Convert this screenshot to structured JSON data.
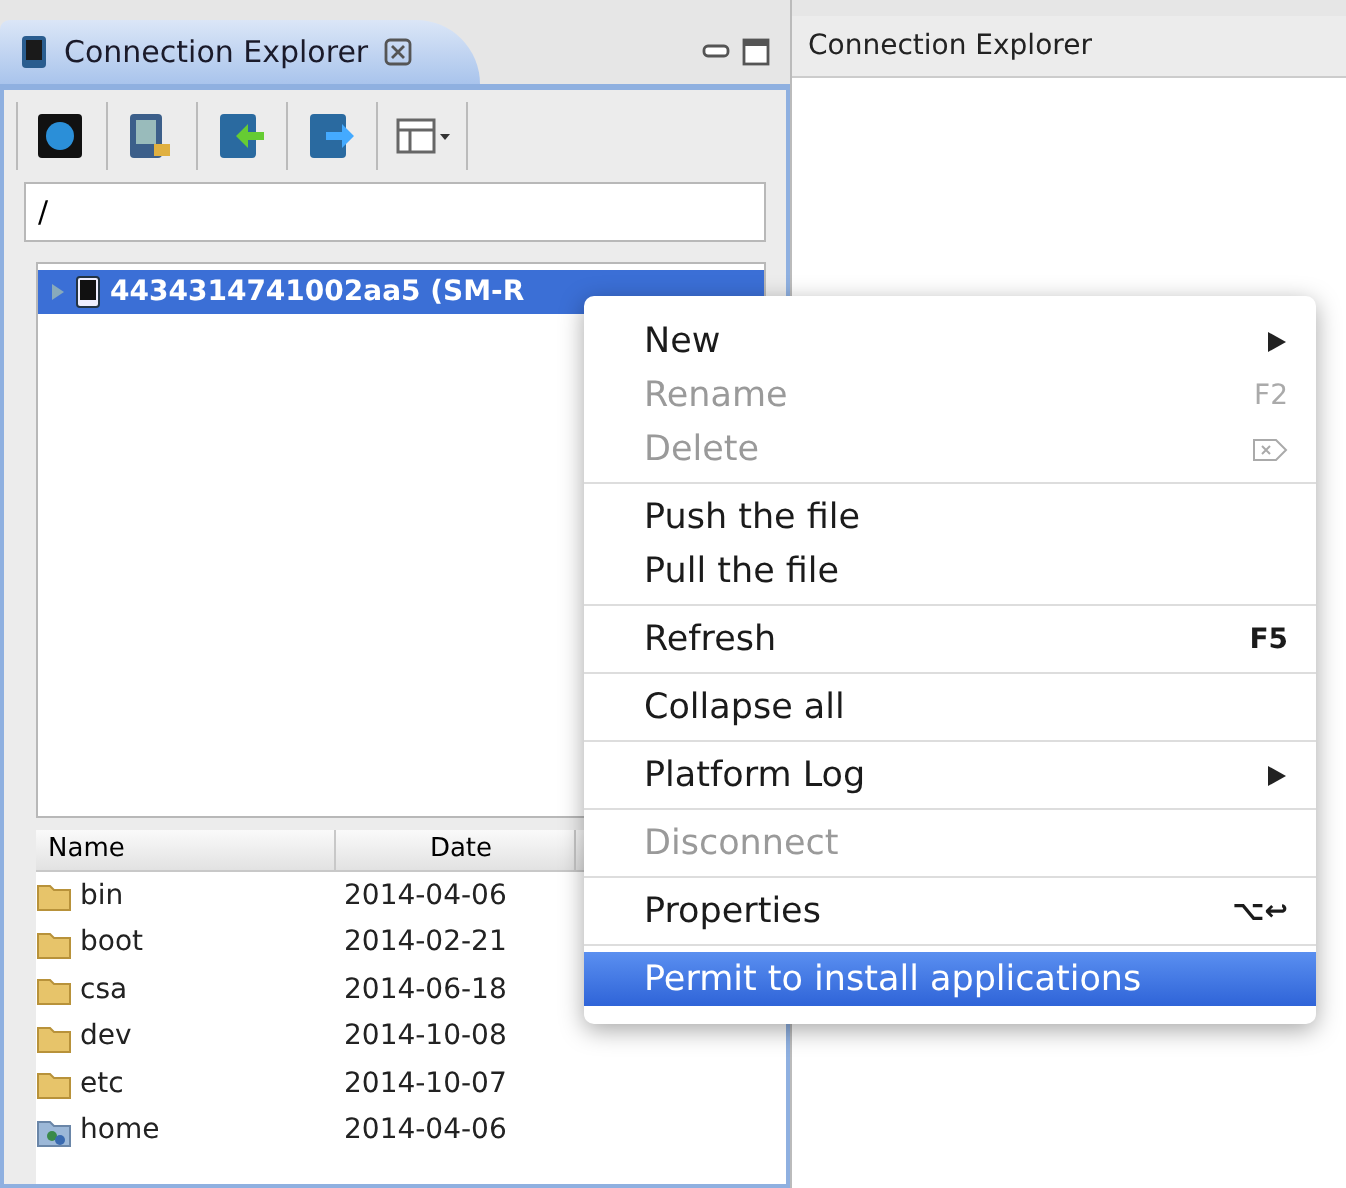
{
  "left_view": {
    "tab": {
      "title": "Connection Explorer",
      "selected": true
    },
    "path_field": {
      "value": "/"
    },
    "tree": [
      {
        "label": "4434314741002aa5 (SM-R",
        "selected": true,
        "expanded": false
      }
    ],
    "table": {
      "columns": [
        "Name",
        "Date"
      ],
      "rows": [
        {
          "kind": "folder",
          "name": "bin",
          "date": "2014-04-06"
        },
        {
          "kind": "folder",
          "name": "boot",
          "date": "2014-02-21"
        },
        {
          "kind": "folder",
          "name": "csa",
          "date": "2014-06-18"
        },
        {
          "kind": "folder",
          "name": "dev",
          "date": "2014-10-08"
        },
        {
          "kind": "folder",
          "name": "etc",
          "date": "2014-10-07"
        },
        {
          "kind": "user-folder",
          "name": "home",
          "date": "2014-04-06"
        }
      ]
    }
  },
  "right_view": {
    "title": "Connection Explorer"
  },
  "context_menu": {
    "groups": [
      [
        {
          "kind": "submenu",
          "label": "New",
          "disabled": false,
          "selected": false
        },
        {
          "kind": "command",
          "label": "Rename",
          "shortcut": "F2",
          "disabled": true,
          "selected": false
        },
        {
          "kind": "key-icon",
          "label": "Delete",
          "disabled": true,
          "selected": false
        }
      ],
      [
        {
          "kind": "command",
          "label": "Push the file",
          "disabled": false,
          "selected": false
        },
        {
          "kind": "command",
          "label": "Pull the file",
          "disabled": false,
          "selected": false
        }
      ],
      [
        {
          "kind": "command",
          "label": "Refresh",
          "shortcut": "F5",
          "disabled": false,
          "selected": false
        }
      ],
      [
        {
          "kind": "command",
          "label": "Collapse all",
          "disabled": false,
          "selected": false
        }
      ],
      [
        {
          "kind": "submenu",
          "label": "Platform Log",
          "disabled": false,
          "selected": false
        }
      ],
      [
        {
          "kind": "command",
          "label": "Disconnect",
          "disabled": true,
          "selected": false
        }
      ],
      [
        {
          "kind": "command",
          "label": "Properties",
          "shortcut": "⌥↩",
          "disabled": false,
          "selected": false
        }
      ],
      [
        {
          "kind": "command",
          "label": "Permit to install applications",
          "disabled": false,
          "selected": true
        }
      ]
    ]
  }
}
